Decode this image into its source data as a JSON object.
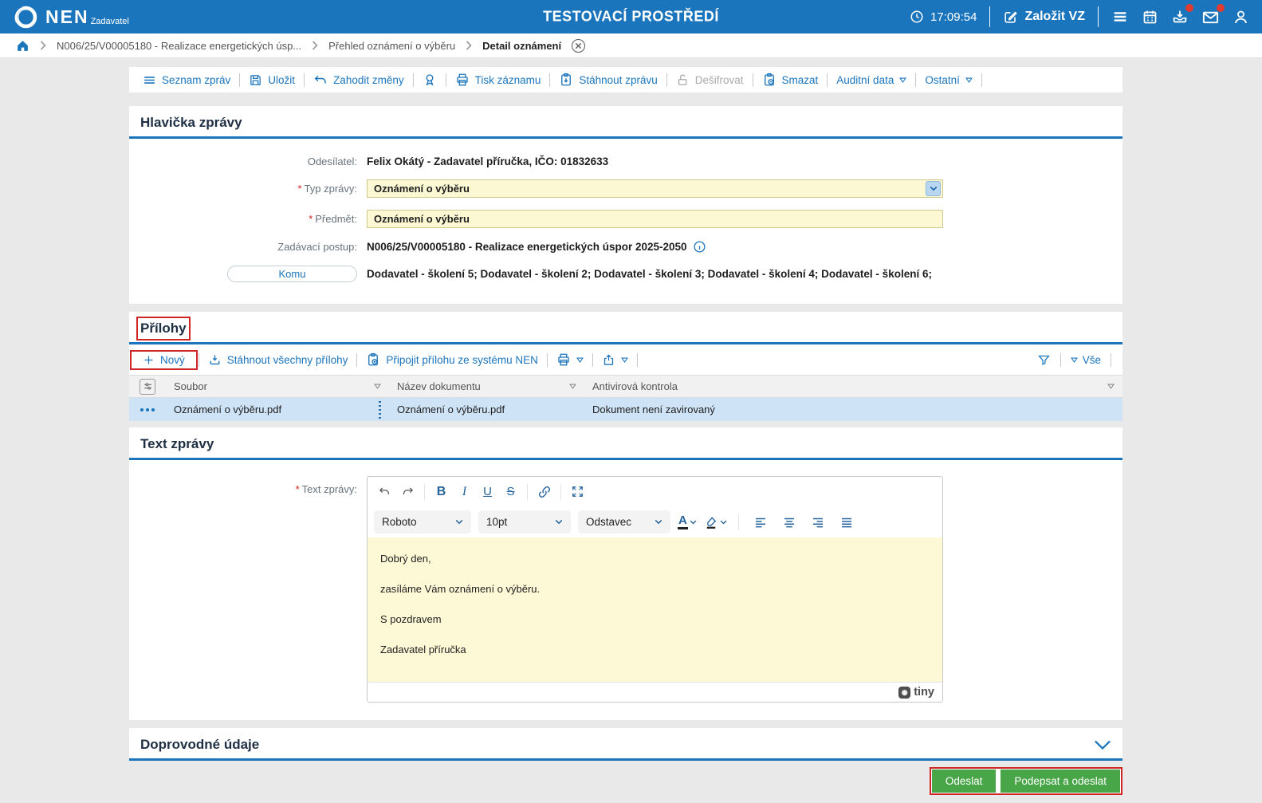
{
  "header": {
    "logo": "NEN",
    "logo_sub": "Zadavatel",
    "env_title": "TESTOVACÍ PROSTŘEDÍ",
    "time": "17:09:54",
    "zalozit_vz": "Založit VZ"
  },
  "breadcrumb": {
    "items": [
      "N006/25/V00005180 - Realizace energetických úsp...",
      "Přehled oznámení o výběru",
      "Detail oznámení"
    ]
  },
  "toolbar": {
    "seznam_zprav": "Seznam zpráv",
    "ulozit": "Uložit",
    "zahodit_zmeny": "Zahodit změny",
    "tisk_zaznamu": "Tisk záznamu",
    "stahnout_zpravu": "Stáhnout zprávu",
    "desifrovat": "Dešifrovat",
    "smazat": "Smazat",
    "auditni_data": "Auditní data",
    "ostatni": "Ostatní"
  },
  "hlavicka": {
    "heading": "Hlavička zprávy",
    "odesilatel_label": "Odesílatel:",
    "odesilatel_value": "Felix Okátý - Zadavatel příručka, IČO: 01832633",
    "typ_zpravy_label": "Typ zprávy:",
    "typ_zpravy_value": "Oznámení o výběru",
    "predmet_label": "Předmět:",
    "predmet_value": "Oznámení o výběru",
    "zadavaci_postup_label": "Zadávací postup:",
    "zadavaci_postup_value": "N006/25/V00005180 - Realizace energetických úspor 2025-2050",
    "komu_label": "Komu",
    "komu_value": "Dodavatel - školení 5; Dodavatel - školení 2; Dodavatel - školení 3; Dodavatel - školení 4; Dodavatel - školení 6;"
  },
  "prilohy": {
    "heading": "Přílohy",
    "novy": "Nový",
    "stahnout_vsechny": "Stáhnout všechny přílohy",
    "pripojit": "Připojit přílohu ze systému NEN",
    "vse": "Vše",
    "table": {
      "columns": [
        "Soubor",
        "Název dokumentu",
        "Antivirová kontrola"
      ],
      "rows": [
        {
          "soubor": "Oznámení o výběru.pdf",
          "nazev": "Oznámení o výběru.pdf",
          "antivir": "Dokument není zavirovaný"
        }
      ]
    }
  },
  "text_zpravy": {
    "heading": "Text zprávy",
    "label": "Text zprávy:",
    "editor": {
      "font": "Roboto",
      "size": "10pt",
      "block": "Odstavec",
      "color_letter": "A",
      "paragraphs": [
        "Dobrý den,",
        "zasíláme Vám oznámení o výběru.",
        "S pozdravem",
        "Zadavatel příručka"
      ],
      "brand": "tiny"
    }
  },
  "doprovodne": {
    "heading": "Doprovodné údaje"
  },
  "footer": {
    "odeslat": "Odeslat",
    "podepsat": "Podepsat a odeslat"
  },
  "icons": {
    "names": [
      "nen-logo-icon",
      "clock-icon",
      "compose-icon",
      "hamburger-icon",
      "calendar-icon",
      "inbox-download-icon",
      "envelope-icon",
      "user-icon",
      "home-icon",
      "chevron-right-icon",
      "close-circle-icon",
      "list-icon",
      "save-icon",
      "undo-icon",
      "award-icon",
      "printer-icon",
      "clipboard-download-icon",
      "lock-open-icon",
      "clipboard-delete-icon",
      "caret-down-icon",
      "plus-icon",
      "download-tray-icon",
      "clipboard-attach-icon",
      "share-icon",
      "filter-icon",
      "sliders-icon",
      "row-menu-icon",
      "drag-handle",
      "undo-icon",
      "redo-icon",
      "bold-icon",
      "italic-icon",
      "underline-icon",
      "strikethrough-icon",
      "link-icon",
      "fullscreen-icon",
      "text-color-icon",
      "highlight-icon",
      "align-left-icon",
      "align-center-icon",
      "align-right-icon",
      "align-justify-icon",
      "info-icon",
      "chevron-down-icon",
      "tiny-logo-icon"
    ]
  },
  "colors": {
    "header_blue": "#1b75bc",
    "accent_blue": "#1b75bc",
    "field_yellow": "#fcf8d3",
    "selected_row_blue": "#cfe3f7",
    "button_green": "#48a648",
    "annotation_red": "#cf2526",
    "badge_red": "#e23b30"
  }
}
